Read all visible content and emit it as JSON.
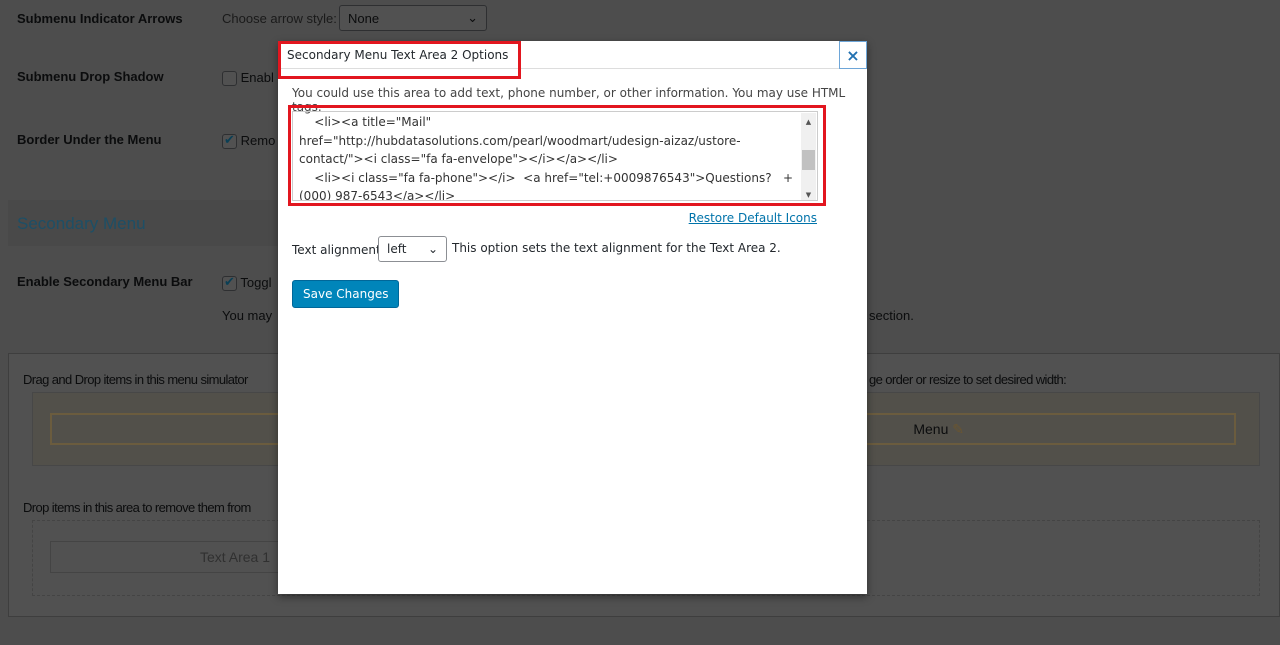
{
  "background": {
    "rows": [
      {
        "label": "Submenu Indicator Arrows",
        "control_label": "Choose arrow style:",
        "select_value": "None"
      },
      {
        "label": "Submenu Drop Shadow",
        "checkbox_label": "Enabl",
        "checked": false
      },
      {
        "label": "Border Under the Menu",
        "checkbox_label": "Remo",
        "checked": true
      }
    ],
    "section_title": "Secondary Menu",
    "enable_row": {
      "label": "Enable Secondary Menu Bar",
      "checkbox_label": "Toggl",
      "checked": true,
      "note_left": "You may",
      "note_right": "section."
    },
    "simulator": {
      "instructions_left": "Drag and Drop items in this menu simulator",
      "instructions_right": "ge order or resize to set desired width:",
      "menu_item": "Menu"
    },
    "remove_area": {
      "instructions": "Drop items in this area to remove them from",
      "item": "Text Area 1"
    }
  },
  "modal": {
    "title": "Secondary Menu Text Area 2 Options",
    "close_label": "×",
    "description": "You could use this area to add text, phone number, or other information. You may use HTML tags.",
    "textarea_value": "    <li><a title=\"Mail\" href=\"http://hubdatasolutions.com/pearl/woodmart/udesign-aizaz/ustore-contact/\"><i class=\"fa fa-envelope\"></i></a></li>\n    <li><i class=\"fa fa-phone\"></i>  <a href=\"tel:+0009876543\">Questions?   +(000) 987-6543</a></li>\n</ul>",
    "restore_link": "Restore Default Icons",
    "alignment_label": "Text alignment:",
    "alignment_value": "left",
    "alignment_note": "This option sets the text alignment for the Text Area 2.",
    "save_label": "Save Changes"
  },
  "colors": {
    "highlight": "#e2161f",
    "primary": "#0085ba",
    "section_title": "#0073aa"
  }
}
